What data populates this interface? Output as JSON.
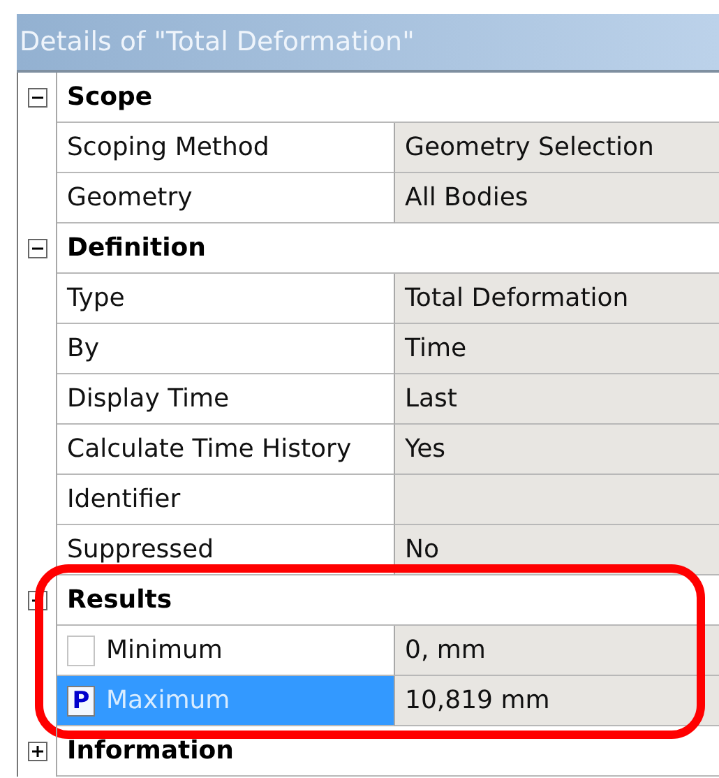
{
  "panel": {
    "title": "Details of \"Total Deformation\""
  },
  "groups": [
    {
      "name": "Scope",
      "expanded": true,
      "highlighted": false,
      "properties": [
        {
          "label": "Scoping Method",
          "value": "Geometry Selection",
          "selected": false
        },
        {
          "label": "Geometry",
          "value": "All Bodies",
          "selected": false
        }
      ]
    },
    {
      "name": "Definition",
      "expanded": true,
      "highlighted": false,
      "properties": [
        {
          "label": "Type",
          "value": "Total Deformation",
          "selected": false
        },
        {
          "label": "By",
          "value": "Time",
          "selected": false
        },
        {
          "label": "Display Time",
          "value": "Last",
          "selected": false
        },
        {
          "label": "Calculate Time History",
          "value": "Yes",
          "selected": false
        },
        {
          "label": "Identifier",
          "selected": false
        },
        {
          "label": "Suppressed",
          "value": "No",
          "selected": false
        }
      ]
    },
    {
      "name": "Results",
      "expanded": true,
      "highlighted": true,
      "properties": [
        {
          "label": "Minimum",
          "value": "0, mm",
          "selected": false,
          "parameter": {
            "checked": false
          }
        },
        {
          "label": "Maximum",
          "value": "10,819 mm",
          "selected": true,
          "parameter": {
            "checked": true,
            "mark": "P"
          }
        }
      ]
    },
    {
      "name": "Information",
      "expanded": false,
      "highlighted": false
    }
  ]
}
